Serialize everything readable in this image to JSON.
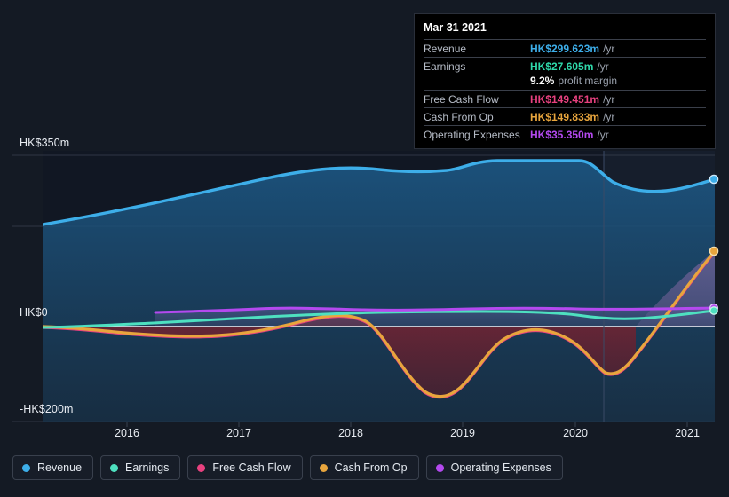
{
  "tooltip": {
    "title": "Mar 31 2021",
    "rows": [
      {
        "key": "Revenue",
        "value": "HK$299.623m",
        "unit": "/yr",
        "color": "#3daee9"
      },
      {
        "key": "Earnings",
        "value": "HK$27.605m",
        "unit": "/yr",
        "color": "#2fd9ab"
      },
      {
        "key": "Free Cash Flow",
        "value": "HK$149.451m",
        "unit": "/yr",
        "color": "#e8417f"
      },
      {
        "key": "Cash From Op",
        "value": "HK$149.833m",
        "unit": "/yr",
        "color": "#e8a53d"
      },
      {
        "key": "Operating Expenses",
        "value": "HK$35.350m",
        "unit": "/yr",
        "color": "#b449ef"
      }
    ],
    "margin_row": {
      "key": "",
      "value": "9.2%",
      "suffix": "profit margin"
    }
  },
  "legend": {
    "items": [
      {
        "label": "Revenue",
        "color": "#3daee9"
      },
      {
        "label": "Earnings",
        "color": "#4ee0c0"
      },
      {
        "label": "Free Cash Flow",
        "color": "#e8417f"
      },
      {
        "label": "Cash From Op",
        "color": "#e8a53d"
      },
      {
        "label": "Operating Expenses",
        "color": "#b449ef"
      }
    ]
  },
  "chart_data": {
    "type": "line",
    "title": "",
    "xlabel": "",
    "ylabel": "",
    "currency": "HK$",
    "units": "millions",
    "ylim": [
      -200,
      350
    ],
    "y_ticks": [
      {
        "label": "HK$350m",
        "value": 350
      },
      {
        "label": "HK$0",
        "value": 0
      },
      {
        "label": "-HK$200m",
        "value": -200
      }
    ],
    "x_ticks": [
      {
        "label": "2016",
        "value": 2016
      },
      {
        "label": "2017",
        "value": 2017
      },
      {
        "label": "2018",
        "value": 2018
      },
      {
        "label": "2019",
        "value": 2019
      },
      {
        "label": "2020",
        "value": 2020
      },
      {
        "label": "2021",
        "value": 2021
      }
    ],
    "grid": true,
    "legend_position": "bottom",
    "forecast_divider_x": 2020.25,
    "x": [
      2015.25,
      2015.75,
      2016.0,
      2016.5,
      2017.0,
      2017.5,
      2018.0,
      2018.5,
      2019.0,
      2019.5,
      2020.0,
      2020.5,
      2021.0,
      2021.25
    ],
    "series": [
      {
        "name": "Revenue",
        "color": "#3daee9",
        "values": [
          207,
          222,
          235,
          256,
          272,
          290,
          308,
          320,
          322,
          337,
          337,
          288,
          282,
          299.623
        ],
        "end_value": 299.623
      },
      {
        "name": "Earnings",
        "color": "#4ee0c0",
        "values": [
          -5,
          -4,
          -3,
          0,
          4,
          10,
          18,
          24,
          26,
          27,
          27,
          18,
          20,
          27.605
        ],
        "end_value": 27.605
      },
      {
        "name": "Free Cash Flow",
        "color": "#e8417f",
        "values": [
          -6,
          -12,
          -16,
          -20,
          -18,
          -2,
          22,
          -60,
          -150,
          -30,
          8,
          -100,
          40,
          149.451
        ],
        "end_value": 149.451
      },
      {
        "name": "Cash From Op",
        "color": "#e8a53d",
        "values": [
          -4,
          -10,
          -14,
          -18,
          -16,
          0,
          25,
          -58,
          -148,
          -28,
          10,
          -98,
          42,
          149.833
        ],
        "end_value": 149.833
      },
      {
        "name": "Operating Expenses",
        "color": "#b449ef",
        "values": [
          null,
          null,
          7,
          9,
          12,
          18,
          26,
          31,
          33,
          34,
          34,
          33,
          33,
          35.35
        ],
        "end_value": 35.35
      }
    ]
  }
}
